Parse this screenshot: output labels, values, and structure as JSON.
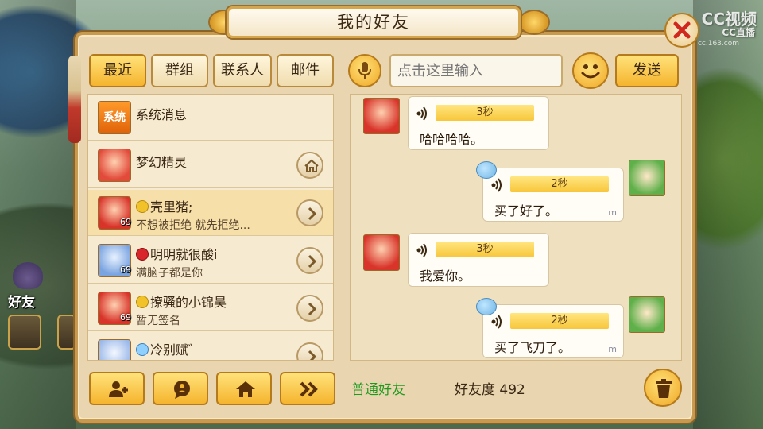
{
  "window": {
    "title": "我的好友",
    "close_icon": "close-x-icon"
  },
  "watermark": {
    "line1": "CC视频",
    "line2": "CC直播",
    "line3": "cc.163.com"
  },
  "tabs": [
    {
      "label": "最近",
      "active": true
    },
    {
      "label": "群组",
      "active": false
    },
    {
      "label": "联系人",
      "active": false
    },
    {
      "label": "邮件",
      "active": false
    }
  ],
  "chat_input": {
    "placeholder": "点击这里输入",
    "send_label": "发送"
  },
  "friends": [
    {
      "name": "系统消息",
      "subtitle": "",
      "level": "",
      "badge": "",
      "avatar_text": "系统",
      "action": ""
    },
    {
      "name": "梦幻精灵",
      "subtitle": "",
      "level": "",
      "badge": "",
      "avatar_text": "",
      "action": "home"
    },
    {
      "name": "壳里猪;",
      "subtitle": "不想被拒绝 就先拒绝...",
      "level": "69",
      "badge": "gold",
      "avatar_text": "",
      "action": "arrow",
      "selected": true
    },
    {
      "name": "明明就很酸i",
      "subtitle": "满脑子都是你",
      "level": "69",
      "badge": "red",
      "avatar_text": "",
      "action": "arrow"
    },
    {
      "name": "撩骚的小锦昊",
      "subtitle": "暂无签名",
      "level": "69",
      "badge": "gold",
      "avatar_text": "",
      "action": "arrow"
    },
    {
      "name": "冷别赋゛",
      "subtitle": "",
      "level": "",
      "badge": "blue",
      "avatar_text": "",
      "action": "arrow"
    }
  ],
  "messages": [
    {
      "side": "left",
      "duration": "3秒",
      "text": "哈哈哈哈。"
    },
    {
      "side": "right",
      "duration": "2秒",
      "text": "买了好了。",
      "mark": "m"
    },
    {
      "side": "left",
      "duration": "3秒",
      "text": "我爱你。"
    },
    {
      "side": "right",
      "duration": "2秒",
      "text": "买了飞刀了。",
      "mark": "m"
    }
  ],
  "footer": {
    "friend_type": "普通好友",
    "friendship_label": "好友度 492"
  },
  "hud": {
    "friend_label": "好友"
  },
  "colors": {
    "panel": "#e9d6b0",
    "button_gold": "#f5b42e",
    "friend_type_green": "#1f9a1f",
    "voice_bar": "#f7c63a"
  }
}
